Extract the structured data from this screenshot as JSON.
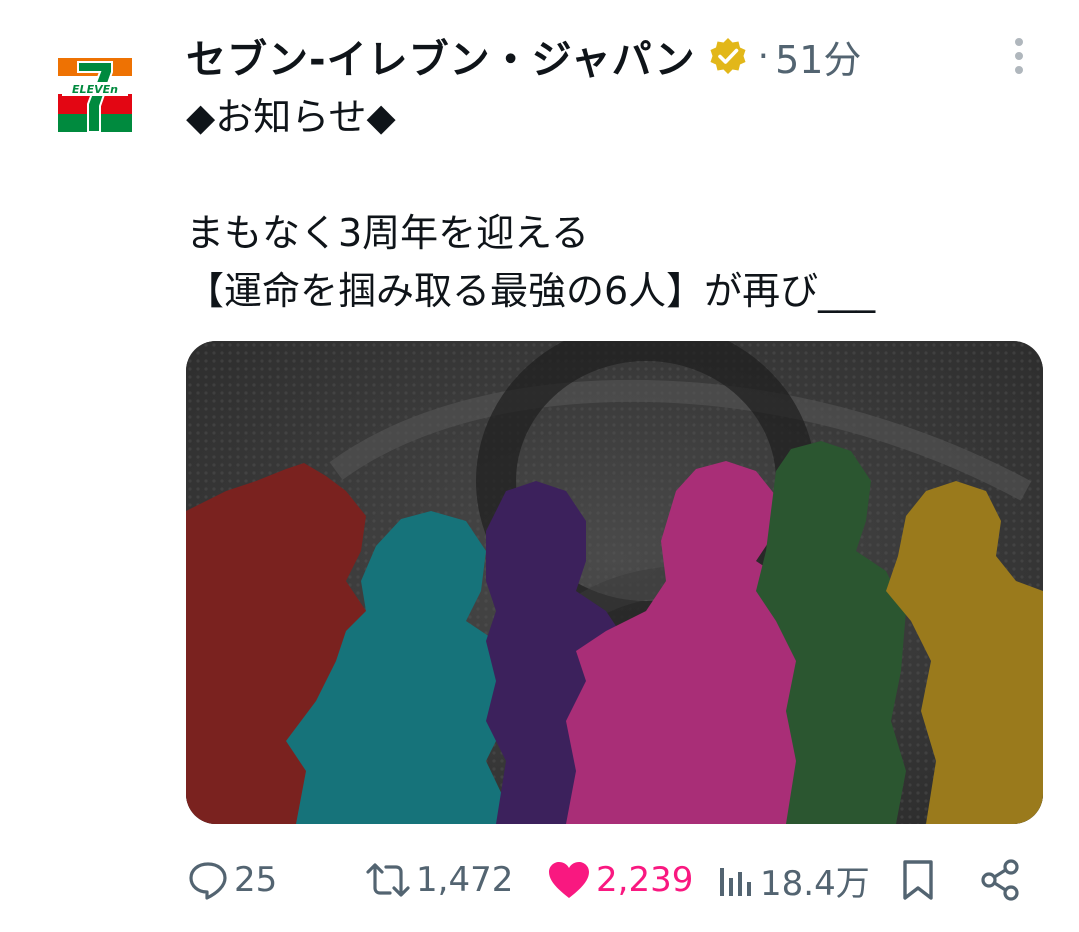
{
  "account": {
    "display_name": "セブン‐イレブン・ジャパン",
    "verified_badge": "verified-badge-icon",
    "separator": "·",
    "time": "51分",
    "logo_text": "ELEVEn",
    "logo_numeral": "7"
  },
  "post": {
    "lines": [
      "◆お知らせ◆",
      "",
      "まもなく3周年を迎える",
      "【運命を掴み取る最強の6人】が再び___"
    ]
  },
  "media": {
    "description_icon": "image",
    "silhouette_colors": [
      "#7a221f",
      "#16737a",
      "#3c215c",
      "#a92e77",
      "#2b5630",
      "#9a7a1c"
    ]
  },
  "actions": {
    "reply_count": "25",
    "retweet_count": "1,472",
    "like_count": "2,239",
    "views_count": "18.4万"
  },
  "colors": {
    "text": "#0f1419",
    "secondary": "#536471",
    "like": "#f91880",
    "verified": "#e2b719",
    "seven_green": "#008a3e",
    "seven_orange": "#ee7203",
    "seven_red": "#e30613"
  }
}
